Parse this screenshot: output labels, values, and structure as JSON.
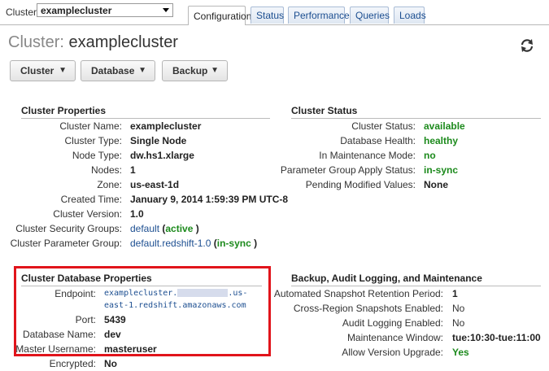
{
  "header": {
    "cluster_label": "Cluster:",
    "cluster_select_value": "examplecluster",
    "tabs": [
      "Configuration",
      "Status",
      "Performance",
      "Queries",
      "Loads"
    ]
  },
  "page": {
    "title_label": "Cluster:",
    "title_name": "examplecluster",
    "buttons": [
      "Cluster",
      "Database",
      "Backup"
    ]
  },
  "cluster_properties": {
    "title": "Cluster Properties",
    "rows": [
      {
        "key": "Cluster Name:",
        "value": "examplecluster"
      },
      {
        "key": "Cluster Type:",
        "value": "Single Node"
      },
      {
        "key": "Node Type:",
        "value": "dw.hs1.xlarge"
      },
      {
        "key": "Nodes:",
        "value": "1"
      },
      {
        "key": "Zone:",
        "value": "us-east-1d"
      },
      {
        "key": "Created Time:",
        "value": "January 9, 2014 1:59:39 PM UTC-8"
      },
      {
        "key": "Cluster Version:",
        "value": "1.0"
      }
    ],
    "security_groups": {
      "key": "Cluster Security Groups:",
      "link": "default",
      "status": "active"
    },
    "parameter_group": {
      "key": "Cluster Parameter Group:",
      "link": "default.redshift-1.0",
      "status": "in-sync"
    }
  },
  "cluster_status": {
    "title": "Cluster Status",
    "rows": [
      {
        "key": "Cluster Status:",
        "value": "available"
      },
      {
        "key": "Database Health:",
        "value": "healthy"
      },
      {
        "key": "In Maintenance Mode:",
        "value": "no"
      },
      {
        "key": "Parameter Group Apply Status:",
        "value": "in-sync"
      },
      {
        "key": "Pending Modified Values:",
        "value": "None"
      }
    ]
  },
  "db_properties": {
    "title": "Cluster Database Properties",
    "endpoint_key": "Endpoint:",
    "endpoint_part1": "examplecluster.",
    "endpoint_part2": ".us-",
    "endpoint_part3": "east-1.redshift.amazonaws.com",
    "rows": [
      {
        "key": "Port:",
        "value": "5439"
      },
      {
        "key": "Database Name:",
        "value": "dev"
      },
      {
        "key": "Master Username:",
        "value": "masteruser"
      },
      {
        "key": "Encrypted:",
        "value": "No"
      }
    ]
  },
  "backup": {
    "title": "Backup, Audit Logging, and Maintenance",
    "rows": [
      {
        "key": "Automated Snapshot Retention Period:",
        "value": "1"
      },
      {
        "key": "Cross-Region Snapshots Enabled:",
        "value": "No"
      },
      {
        "key": "Audit Logging Enabled:",
        "value": "No"
      },
      {
        "key": "Maintenance Window:",
        "value": "tue:10:30-tue:11:00"
      },
      {
        "key": "Allow Version Upgrade:",
        "value": "Yes"
      }
    ]
  },
  "colors": {
    "status_green": "#1c8a1c",
    "link_blue": "#1d4f91",
    "highlight_red": "#e1141b"
  }
}
